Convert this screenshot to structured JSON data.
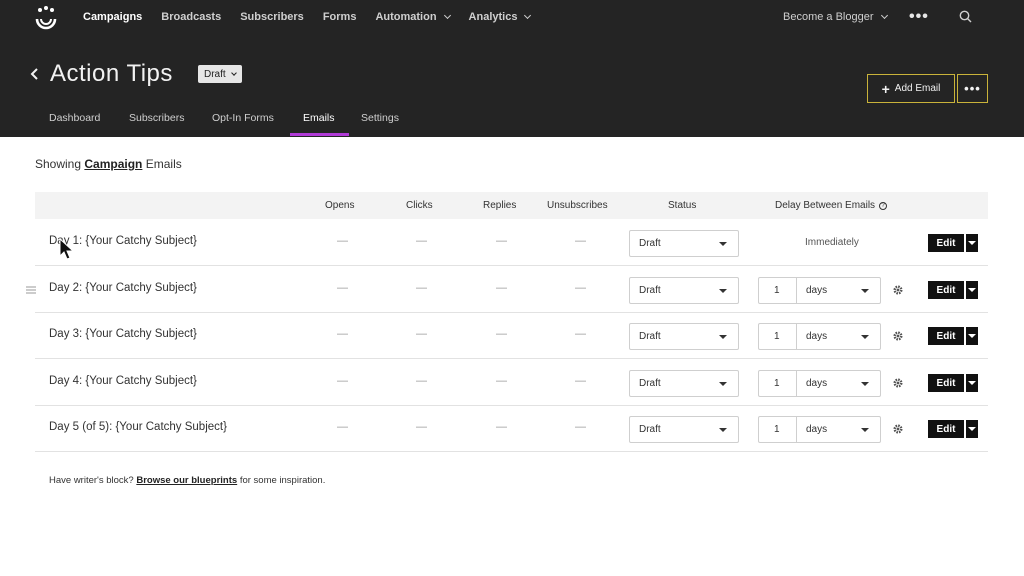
{
  "nav": {
    "items": [
      {
        "label": "Campaigns",
        "active": true,
        "dropdown": false
      },
      {
        "label": "Broadcasts",
        "active": false,
        "dropdown": false
      },
      {
        "label": "Subscribers",
        "active": false,
        "dropdown": false
      },
      {
        "label": "Forms",
        "active": false,
        "dropdown": false
      },
      {
        "label": "Automation",
        "active": false,
        "dropdown": true
      },
      {
        "label": "Analytics",
        "active": false,
        "dropdown": true
      }
    ],
    "account_label": "Become a Blogger",
    "more_icon": "more-horizontal-icon",
    "search_icon": "search-icon"
  },
  "page": {
    "title": "Action Tips",
    "status_badge": "Draft",
    "add_email_label": "Add Email",
    "more_label": "•••"
  },
  "tabs": [
    {
      "label": "Dashboard",
      "active": false
    },
    {
      "label": "Subscribers",
      "active": false
    },
    {
      "label": "Opt-In Forms",
      "active": false
    },
    {
      "label": "Emails",
      "active": true
    },
    {
      "label": "Settings",
      "active": false
    }
  ],
  "showing": {
    "prefix": "Showing",
    "link": "Campaign",
    "suffix": "Emails"
  },
  "table": {
    "columns": [
      "Opens",
      "Clicks",
      "Replies",
      "Unsubscribes",
      "Status",
      "Delay Between Emails"
    ],
    "rows": [
      {
        "subject": "Day 1: {Your Catchy Subject}",
        "opens": "—",
        "clicks": "—",
        "replies": "—",
        "unsubscribes": "—",
        "status": "Draft",
        "delay_text": "Immediately",
        "delay_num": "",
        "delay_unit": "",
        "edit": "Edit"
      },
      {
        "subject": "Day 2: {Your Catchy Subject}",
        "opens": "—",
        "clicks": "—",
        "replies": "—",
        "unsubscribes": "—",
        "status": "Draft",
        "delay_text": "",
        "delay_num": "1",
        "delay_unit": "days",
        "edit": "Edit"
      },
      {
        "subject": "Day 3: {Your Catchy Subject}",
        "opens": "—",
        "clicks": "—",
        "replies": "—",
        "unsubscribes": "—",
        "status": "Draft",
        "delay_text": "",
        "delay_num": "1",
        "delay_unit": "days",
        "edit": "Edit"
      },
      {
        "subject": "Day 4: {Your Catchy Subject}",
        "opens": "—",
        "clicks": "—",
        "replies": "—",
        "unsubscribes": "—",
        "status": "Draft",
        "delay_text": "",
        "delay_num": "1",
        "delay_unit": "days",
        "edit": "Edit"
      },
      {
        "subject": "Day 5 (of 5): {Your Catchy Subject}",
        "opens": "—",
        "clicks": "—",
        "replies": "—",
        "unsubscribes": "—",
        "status": "Draft",
        "delay_text": "",
        "delay_num": "1",
        "delay_unit": "days",
        "edit": "Edit"
      }
    ]
  },
  "footer": {
    "prefix": "Have writer's block?",
    "link": "Browse our blueprints",
    "suffix": "for some inspiration."
  },
  "colors": {
    "header_bg": "#242424",
    "accent_underline": "#b03ad6",
    "button_border": "#c9b33a"
  }
}
